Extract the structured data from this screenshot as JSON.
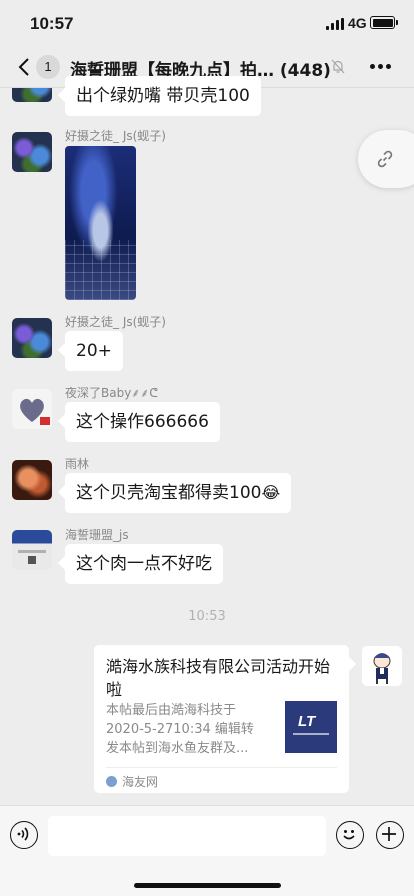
{
  "status_bar": {
    "time": "10:57",
    "network": "4G"
  },
  "nav": {
    "back_badge": "1",
    "title": "海誓珊盟【每晚九点】拍… (448)"
  },
  "messages": [
    {
      "sender": "",
      "text": "出个绿奶嘴  带贝壳100"
    },
    {
      "sender": "好摄之徒_ Js(蚬子)",
      "type": "image"
    },
    {
      "sender": "好摄之徒_ Js(蚬子)",
      "text": "20+"
    },
    {
      "sender": "夜深了Baby⸙⸙ᕦ",
      "text": "这个操作666666"
    },
    {
      "sender": "雨林",
      "text": "这个贝壳淘宝都得卖100",
      "emoji": "😂"
    },
    {
      "sender": "海誓珊盟_js",
      "text": "这个肉一点不好吃"
    }
  ],
  "time_divider": "10:53",
  "link_card": {
    "title": "澔海水族科技有限公司活动开始啦",
    "description": "本帖最后由澔海科技于 2020-5-2710:34 编辑转发本帖到海水鱼友群及...",
    "source": "海友网"
  },
  "input": {
    "placeholder": ""
  },
  "icons": {
    "back": "chevron-left-icon",
    "mute": "bell-muted-icon",
    "more": "more-dots-icon",
    "link": "link-icon",
    "voice": "voice-icon",
    "emoji": "emoji-icon",
    "plus": "plus-icon"
  },
  "colors": {
    "background": "#ededed",
    "bubble": "#ffffff",
    "meta_text": "#888888",
    "card_thumb": "#2b3a7a"
  }
}
